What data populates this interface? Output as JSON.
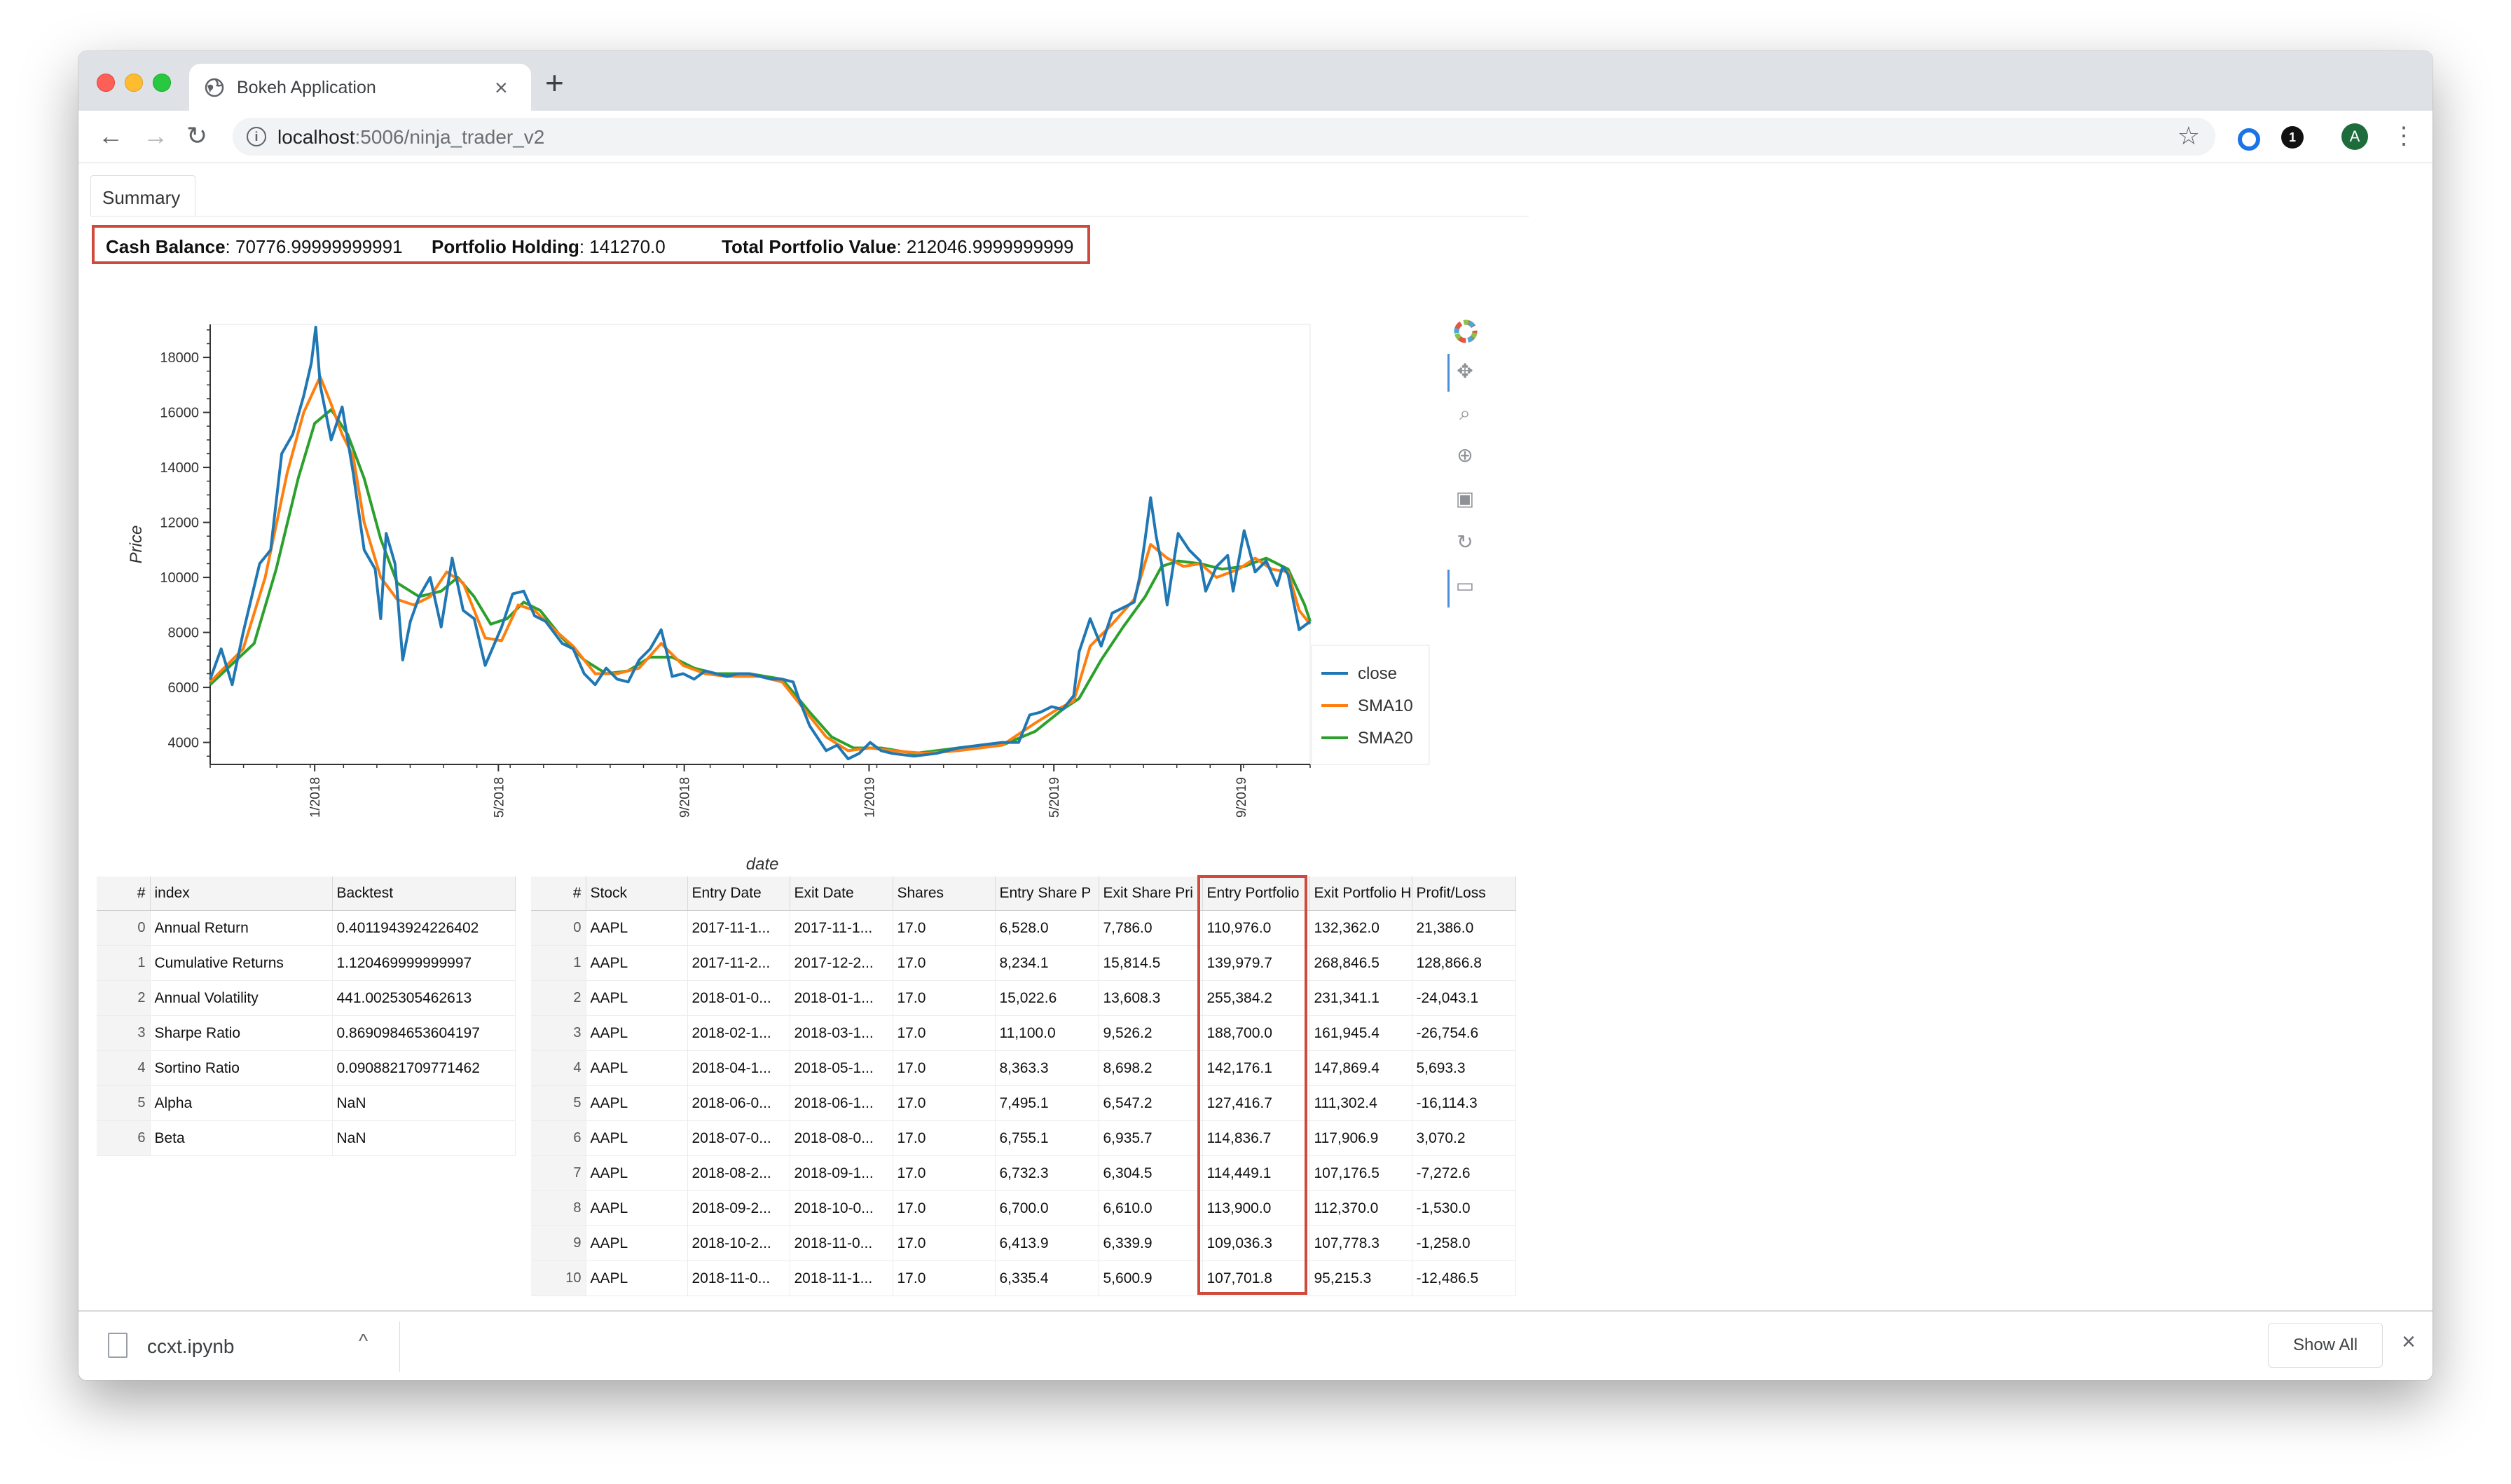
{
  "browser": {
    "tab_title": "Bokeh Application",
    "tab_close": "×",
    "new_tab": "+",
    "url_host": "localhost",
    "url_path": ":5006/ninja_trader_v2",
    "avatar_letter": "A",
    "ext2_label": "1"
  },
  "page": {
    "summary_tab": "Summary",
    "stats": {
      "cash_label": "Cash Balance",
      "cash_value": ": 70776.99999999991",
      "holding_label": "Portfolio Holding",
      "holding_value": ": 141270.0",
      "total_label": "Total Portfolio Value",
      "total_value": ": 212046.9999999999"
    }
  },
  "chart_data": {
    "type": "line",
    "xlabel": "date",
    "ylabel": "Price",
    "ylim": [
      3200,
      19200
    ],
    "yticks": [
      4000,
      6000,
      8000,
      10000,
      12000,
      14000,
      16000,
      18000
    ],
    "xticks": [
      "1/2018",
      "5/2018",
      "9/2018",
      "1/2019",
      "5/2019",
      "9/2019"
    ],
    "xtick_pos": [
      0.095,
      0.262,
      0.431,
      0.599,
      0.767,
      0.937
    ],
    "legend_position": "bottom-right, outside plot",
    "series": [
      {
        "name": "close",
        "color": "#1f77b4",
        "points": [
          [
            0.0,
            6300
          ],
          [
            0.01,
            7400
          ],
          [
            0.02,
            6100
          ],
          [
            0.03,
            8000
          ],
          [
            0.045,
            10500
          ],
          [
            0.055,
            11000
          ],
          [
            0.065,
            14500
          ],
          [
            0.075,
            15200
          ],
          [
            0.085,
            16600
          ],
          [
            0.092,
            17800
          ],
          [
            0.096,
            19100
          ],
          [
            0.1,
            17000
          ],
          [
            0.11,
            15000
          ],
          [
            0.12,
            16200
          ],
          [
            0.13,
            13800
          ],
          [
            0.14,
            11000
          ],
          [
            0.15,
            10300
          ],
          [
            0.155,
            8500
          ],
          [
            0.16,
            11600
          ],
          [
            0.168,
            10500
          ],
          [
            0.175,
            7000
          ],
          [
            0.182,
            8400
          ],
          [
            0.19,
            9300
          ],
          [
            0.2,
            10000
          ],
          [
            0.21,
            8200
          ],
          [
            0.22,
            10700
          ],
          [
            0.23,
            8800
          ],
          [
            0.24,
            8500
          ],
          [
            0.25,
            6800
          ],
          [
            0.265,
            8200
          ],
          [
            0.275,
            9400
          ],
          [
            0.285,
            9500
          ],
          [
            0.295,
            8600
          ],
          [
            0.305,
            8400
          ],
          [
            0.32,
            7600
          ],
          [
            0.33,
            7400
          ],
          [
            0.34,
            6500
          ],
          [
            0.35,
            6100
          ],
          [
            0.36,
            6700
          ],
          [
            0.37,
            6300
          ],
          [
            0.38,
            6200
          ],
          [
            0.39,
            7000
          ],
          [
            0.4,
            7400
          ],
          [
            0.41,
            8100
          ],
          [
            0.415,
            7300
          ],
          [
            0.42,
            6400
          ],
          [
            0.43,
            6500
          ],
          [
            0.44,
            6300
          ],
          [
            0.45,
            6600
          ],
          [
            0.46,
            6500
          ],
          [
            0.47,
            6400
          ],
          [
            0.48,
            6500
          ],
          [
            0.49,
            6500
          ],
          [
            0.5,
            6400
          ],
          [
            0.51,
            6300
          ],
          [
            0.52,
            6300
          ],
          [
            0.53,
            6200
          ],
          [
            0.535,
            5600
          ],
          [
            0.545,
            4600
          ],
          [
            0.56,
            3700
          ],
          [
            0.57,
            3900
          ],
          [
            0.58,
            3400
          ],
          [
            0.59,
            3600
          ],
          [
            0.6,
            4000
          ],
          [
            0.61,
            3700
          ],
          [
            0.62,
            3600
          ],
          [
            0.64,
            3500
          ],
          [
            0.66,
            3600
          ],
          [
            0.68,
            3800
          ],
          [
            0.7,
            3900
          ],
          [
            0.72,
            4000
          ],
          [
            0.735,
            4000
          ],
          [
            0.745,
            5000
          ],
          [
            0.755,
            5100
          ],
          [
            0.765,
            5300
          ],
          [
            0.775,
            5200
          ],
          [
            0.785,
            5700
          ],
          [
            0.79,
            7300
          ],
          [
            0.8,
            8500
          ],
          [
            0.81,
            7500
          ],
          [
            0.82,
            8700
          ],
          [
            0.83,
            8900
          ],
          [
            0.84,
            9100
          ],
          [
            0.845,
            10000
          ],
          [
            0.85,
            11400
          ],
          [
            0.855,
            12900
          ],
          [
            0.86,
            11500
          ],
          [
            0.865,
            10500
          ],
          [
            0.87,
            9000
          ],
          [
            0.88,
            11600
          ],
          [
            0.89,
            11000
          ],
          [
            0.9,
            10600
          ],
          [
            0.905,
            9500
          ],
          [
            0.915,
            10400
          ],
          [
            0.925,
            10800
          ],
          [
            0.93,
            9500
          ],
          [
            0.94,
            11700
          ],
          [
            0.95,
            10200
          ],
          [
            0.96,
            10600
          ],
          [
            0.97,
            9700
          ],
          [
            0.975,
            10400
          ],
          [
            0.98,
            10100
          ],
          [
            0.99,
            8100
          ],
          [
            1.0,
            8400
          ]
        ]
      },
      {
        "name": "SMA10",
        "color": "#ff7f0e",
        "points": [
          [
            0.0,
            6200
          ],
          [
            0.03,
            7400
          ],
          [
            0.05,
            10000
          ],
          [
            0.07,
            13800
          ],
          [
            0.085,
            16000
          ],
          [
            0.1,
            17300
          ],
          [
            0.11,
            16300
          ],
          [
            0.12,
            15200
          ],
          [
            0.13,
            14400
          ],
          [
            0.14,
            12000
          ],
          [
            0.155,
            10000
          ],
          [
            0.17,
            9200
          ],
          [
            0.185,
            9000
          ],
          [
            0.2,
            9300
          ],
          [
            0.215,
            10200
          ],
          [
            0.23,
            9800
          ],
          [
            0.25,
            7800
          ],
          [
            0.265,
            7700
          ],
          [
            0.28,
            9000
          ],
          [
            0.295,
            8800
          ],
          [
            0.31,
            8200
          ],
          [
            0.33,
            7500
          ],
          [
            0.35,
            6500
          ],
          [
            0.37,
            6500
          ],
          [
            0.39,
            6700
          ],
          [
            0.41,
            7600
          ],
          [
            0.43,
            6800
          ],
          [
            0.45,
            6500
          ],
          [
            0.47,
            6400
          ],
          [
            0.5,
            6400
          ],
          [
            0.52,
            6200
          ],
          [
            0.54,
            5200
          ],
          [
            0.56,
            4200
          ],
          [
            0.58,
            3700
          ],
          [
            0.6,
            3800
          ],
          [
            0.62,
            3700
          ],
          [
            0.65,
            3600
          ],
          [
            0.68,
            3700
          ],
          [
            0.72,
            3900
          ],
          [
            0.75,
            4700
          ],
          [
            0.77,
            5200
          ],
          [
            0.785,
            5500
          ],
          [
            0.8,
            7500
          ],
          [
            0.82,
            8300
          ],
          [
            0.84,
            9200
          ],
          [
            0.855,
            11200
          ],
          [
            0.87,
            10700
          ],
          [
            0.885,
            10400
          ],
          [
            0.9,
            10500
          ],
          [
            0.915,
            10000
          ],
          [
            0.935,
            10300
          ],
          [
            0.95,
            10700
          ],
          [
            0.965,
            10300
          ],
          [
            0.98,
            10200
          ],
          [
            0.99,
            8800
          ],
          [
            1.0,
            8300
          ]
        ]
      },
      {
        "name": "SMA20",
        "color": "#2ca02c",
        "points": [
          [
            0.0,
            6100
          ],
          [
            0.04,
            7600
          ],
          [
            0.06,
            10300
          ],
          [
            0.08,
            13600
          ],
          [
            0.095,
            15600
          ],
          [
            0.11,
            16100
          ],
          [
            0.125,
            15200
          ],
          [
            0.14,
            13600
          ],
          [
            0.155,
            11400
          ],
          [
            0.17,
            9800
          ],
          [
            0.19,
            9300
          ],
          [
            0.21,
            9500
          ],
          [
            0.225,
            10000
          ],
          [
            0.24,
            9300
          ],
          [
            0.255,
            8300
          ],
          [
            0.27,
            8500
          ],
          [
            0.285,
            9100
          ],
          [
            0.3,
            8800
          ],
          [
            0.32,
            7800
          ],
          [
            0.34,
            7000
          ],
          [
            0.36,
            6500
          ],
          [
            0.38,
            6600
          ],
          [
            0.4,
            7100
          ],
          [
            0.42,
            7100
          ],
          [
            0.44,
            6700
          ],
          [
            0.46,
            6500
          ],
          [
            0.49,
            6500
          ],
          [
            0.52,
            6300
          ],
          [
            0.545,
            5100
          ],
          [
            0.565,
            4200
          ],
          [
            0.585,
            3800
          ],
          [
            0.61,
            3800
          ],
          [
            0.64,
            3600
          ],
          [
            0.68,
            3800
          ],
          [
            0.72,
            3900
          ],
          [
            0.75,
            4400
          ],
          [
            0.775,
            5200
          ],
          [
            0.79,
            5600
          ],
          [
            0.81,
            7000
          ],
          [
            0.83,
            8200
          ],
          [
            0.85,
            9300
          ],
          [
            0.865,
            10400
          ],
          [
            0.88,
            10600
          ],
          [
            0.9,
            10500
          ],
          [
            0.92,
            10300
          ],
          [
            0.94,
            10400
          ],
          [
            0.96,
            10700
          ],
          [
            0.98,
            10300
          ],
          [
            0.995,
            9000
          ],
          [
            1.0,
            8400
          ]
        ]
      }
    ]
  },
  "backtest_table": {
    "headers": [
      "#",
      "index",
      "Backtest"
    ],
    "rows": [
      [
        "0",
        "Annual Return",
        "0.4011943924226402"
      ],
      [
        "1",
        "Cumulative Returns",
        "1.120469999999997"
      ],
      [
        "2",
        "Annual Volatility",
        "441.0025305462613"
      ],
      [
        "3",
        "Sharpe Ratio",
        "0.8690984653604197"
      ],
      [
        "4",
        "Sortino Ratio",
        "0.0908821709771462"
      ],
      [
        "5",
        "Alpha",
        "NaN"
      ],
      [
        "6",
        "Beta",
        "NaN"
      ]
    ]
  },
  "trades_table": {
    "headers": [
      "#",
      "Stock",
      "Entry Date",
      "Exit Date",
      "Shares",
      "Entry Share P",
      "Exit Share Pri",
      "Entry Portfolio",
      "Exit Portfolio H",
      "Profit/Loss"
    ],
    "rows": [
      [
        "0",
        "AAPL",
        "2017-11-1...",
        "2017-11-1...",
        "17.0",
        "6,528.0",
        "7,786.0",
        "110,976.0",
        "132,362.0",
        "21,386.0"
      ],
      [
        "1",
        "AAPL",
        "2017-11-2...",
        "2017-12-2...",
        "17.0",
        "8,234.1",
        "15,814.5",
        "139,979.7",
        "268,846.5",
        "128,866.8"
      ],
      [
        "2",
        "AAPL",
        "2018-01-0...",
        "2018-01-1...",
        "17.0",
        "15,022.6",
        "13,608.3",
        "255,384.2",
        "231,341.1",
        "-24,043.1"
      ],
      [
        "3",
        "AAPL",
        "2018-02-1...",
        "2018-03-1...",
        "17.0",
        "11,100.0",
        "9,526.2",
        "188,700.0",
        "161,945.4",
        "-26,754.6"
      ],
      [
        "4",
        "AAPL",
        "2018-04-1...",
        "2018-05-1...",
        "17.0",
        "8,363.3",
        "8,698.2",
        "142,176.1",
        "147,869.4",
        "5,693.3"
      ],
      [
        "5",
        "AAPL",
        "2018-06-0...",
        "2018-06-1...",
        "17.0",
        "7,495.1",
        "6,547.2",
        "127,416.7",
        "111,302.4",
        "-16,114.3"
      ],
      [
        "6",
        "AAPL",
        "2018-07-0...",
        "2018-08-0...",
        "17.0",
        "6,755.1",
        "6,935.7",
        "114,836.7",
        "117,906.9",
        "3,070.2"
      ],
      [
        "7",
        "AAPL",
        "2018-08-2...",
        "2018-09-1...",
        "17.0",
        "6,732.3",
        "6,304.5",
        "114,449.1",
        "107,176.5",
        "-7,272.6"
      ],
      [
        "8",
        "AAPL",
        "2018-09-2...",
        "2018-10-0...",
        "17.0",
        "6,700.0",
        "6,610.0",
        "113,900.0",
        "112,370.0",
        "-1,530.0"
      ],
      [
        "9",
        "AAPL",
        "2018-10-2...",
        "2018-11-0...",
        "17.0",
        "6,413.9",
        "6,339.9",
        "109,036.3",
        "107,778.3",
        "-1,258.0"
      ],
      [
        "10",
        "AAPL",
        "2018-11-0...",
        "2018-11-1...",
        "17.0",
        "6,335.4",
        "5,600.9",
        "107,701.8",
        "95,215.3",
        "-12,486.5"
      ]
    ]
  },
  "download_bar": {
    "file_name": "ccxt.ipynb",
    "show_all": "Show All",
    "chevron": "^",
    "close": "×"
  },
  "colors": {
    "highlight": "#cf4a3d",
    "bokeh_active": "#4c8fd6"
  }
}
